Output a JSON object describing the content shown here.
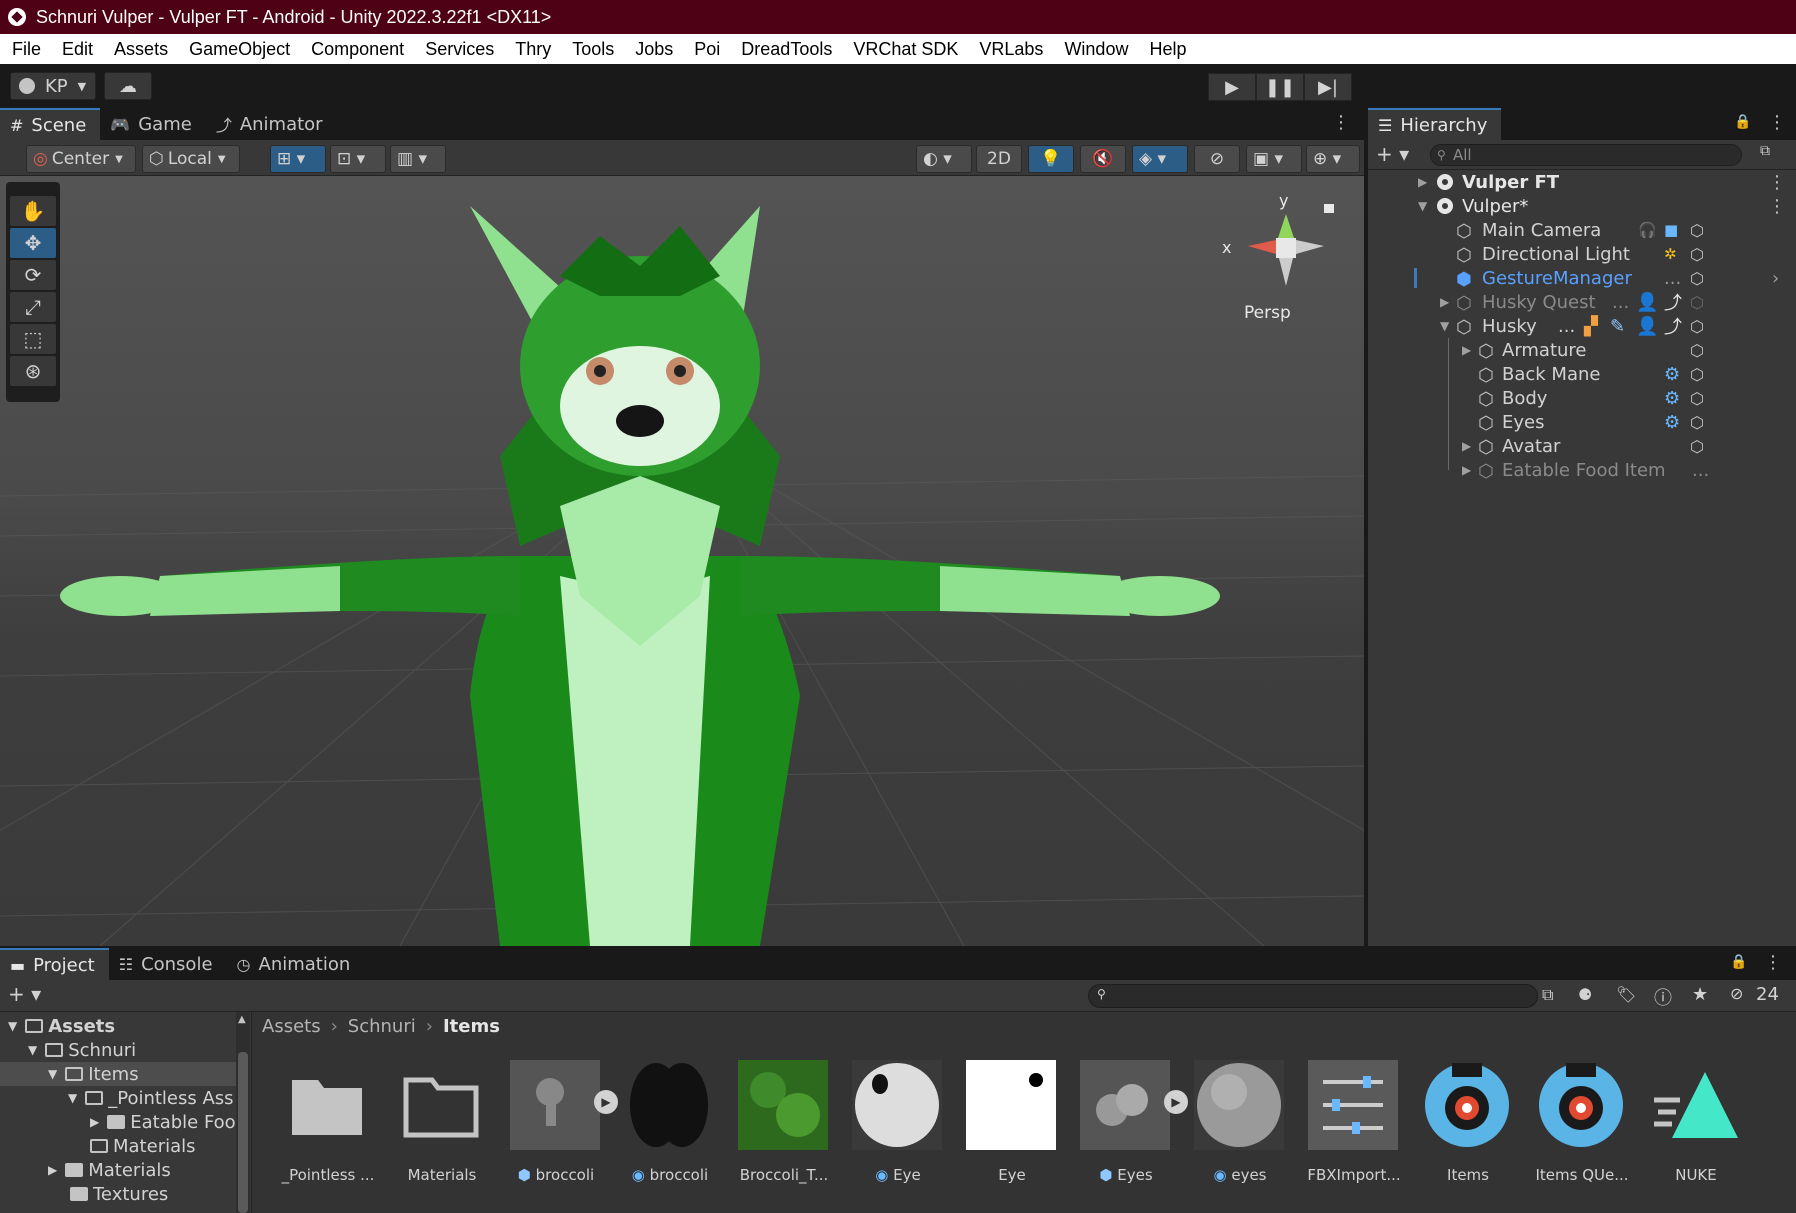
{
  "window": {
    "title": "Schnuri Vulper - Vulper FT - Android - Unity 2022.3.22f1 <DX11>"
  },
  "menu": [
    "File",
    "Edit",
    "Assets",
    "GameObject",
    "Component",
    "Services",
    "Thry",
    "Tools",
    "Jobs",
    "Poi",
    "DreadTools",
    "VRChat SDK",
    "VRLabs",
    "Window",
    "Help"
  ],
  "toolbar": {
    "account_label": "KP"
  },
  "scene_panel": {
    "tabs": [
      "Scene",
      "Game",
      "Animator"
    ],
    "pivot_label": "Center",
    "space_label": "Local",
    "mode_2d_label": "2D",
    "gizmo": {
      "axis_y": "y",
      "axis_x": "x",
      "projection_label": "Persp"
    }
  },
  "hierarchy": {
    "tab_label": "Hierarchy",
    "search_placeholder": "All",
    "rows": [
      {
        "label": "Vulper FT"
      },
      {
        "label": "Vulper*"
      },
      {
        "label": "Main Camera"
      },
      {
        "label": "Directional Light"
      },
      {
        "label": "GestureManager"
      },
      {
        "label": "Husky Quest"
      },
      {
        "label": "Husky"
      },
      {
        "label": "Armature"
      },
      {
        "label": "Back Mane"
      },
      {
        "label": "Body"
      },
      {
        "label": "Eyes"
      },
      {
        "label": "Avatar"
      },
      {
        "label": "Eatable Food Item"
      }
    ],
    "ellipsis": "..."
  },
  "project": {
    "tabs": [
      "Project",
      "Console",
      "Animation"
    ],
    "hidden_count": "24",
    "tree": [
      {
        "label": "Assets"
      },
      {
        "label": "Schnuri"
      },
      {
        "label": "Items"
      },
      {
        "label": "_Pointless Ass"
      },
      {
        "label": "Eatable Foo"
      },
      {
        "label": "Materials"
      },
      {
        "label": "Materials"
      },
      {
        "label": "Textures"
      }
    ],
    "breadcrumb": [
      "Assets",
      "Schnuri",
      "Items"
    ],
    "assets": [
      {
        "name": "_Pointless ..."
      },
      {
        "name": "Materials"
      },
      {
        "name": "broccoli"
      },
      {
        "name": "broccoli"
      },
      {
        "name": "Broccoli_T..."
      },
      {
        "name": "Eye"
      },
      {
        "name": "Eye"
      },
      {
        "name": "Eyes"
      },
      {
        "name": "eyes"
      },
      {
        "name": "FBXImport..."
      },
      {
        "name": "Items"
      },
      {
        "name": "Items QUe..."
      },
      {
        "name": "NUKE"
      }
    ]
  },
  "colors": {
    "title_bar": "#4e0014",
    "accent_blue": "#3a79bb",
    "selected_name": "#5aa0ff",
    "avatar_green": "#1f8a1f",
    "avatar_light_green": "#8fe08f"
  }
}
